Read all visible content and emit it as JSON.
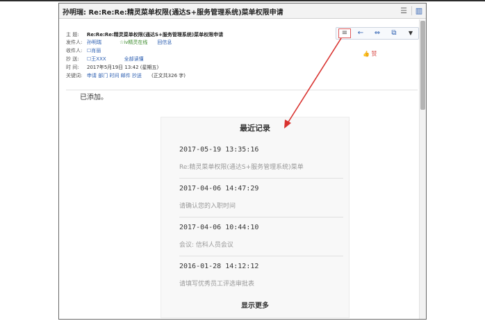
{
  "window": {
    "title": "孙明瑞: Re:Re:Re:精灵菜单权限(通达S+服务管理系统)菜单权限申请"
  },
  "header": {
    "subject_label": "主 题:",
    "subject": "Re:Re:Re:精灵菜单权限(通达S+服务管理系统)菜单权限申请",
    "from_label": "发件人:",
    "from_name": "孙明瑞",
    "from_status": "☆iv精灵在线",
    "from_action": "回信息",
    "to_label": "收件人:",
    "to_value": "☐肖丽",
    "cc_label": "抄 送:",
    "cc_value": "☐王XXX",
    "cc_all": "全部读懂",
    "time_label": "时 间:",
    "time_value": "2017年5月19日 13:42 (星期五)",
    "keywords_label": "关键词:",
    "keywords": [
      "申请",
      "部门",
      "时间",
      "邮件",
      "抄送"
    ],
    "word_count": "(正文共326 字)"
  },
  "toolbar": {
    "like": "👍 赞"
  },
  "body": {
    "text": "已添加。"
  },
  "popup": {
    "title": "最近记录",
    "records": [
      {
        "time": "2017-05-19 13:35:16",
        "subject": "Re:精灵菜单权限(通达S+服务管理系统)菜单"
      },
      {
        "time": "2017-04-06 14:47:29",
        "subject": "请确认您的入职时间"
      },
      {
        "time": "2017-04-06 10:44:10",
        "subject": "会议: 信科人员会议"
      },
      {
        "time": "2016-01-28 14:12:12",
        "subject": "请填写优秀员工评选审批表"
      }
    ],
    "more": "显示更多"
  },
  "colors": {
    "link": "#2a5db0",
    "arrow": "#d9322f",
    "highlight_border": "#e05a5a",
    "status_green": "#3a8a2a"
  }
}
